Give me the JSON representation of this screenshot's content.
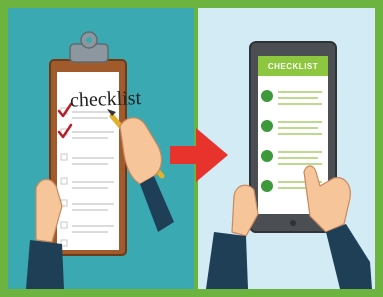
{
  "clipboard": {
    "title": "checklist",
    "items_checked": 2,
    "items_total": 7
  },
  "tablet": {
    "header": "CHECKLIST",
    "items_total": 4
  },
  "colors": {
    "frame": "#6cb33f",
    "left_bg": "#3aa9b2",
    "right_bg": "#d3ebf5",
    "arrow": "#e8332c",
    "check": "#b3202a",
    "tablet_green": "#8dc63f",
    "clipboard_board": "#a15a2c"
  },
  "icons": [
    "clipboard-icon",
    "pen-icon",
    "arrow-right-icon",
    "tablet-icon",
    "hand-icon"
  ]
}
